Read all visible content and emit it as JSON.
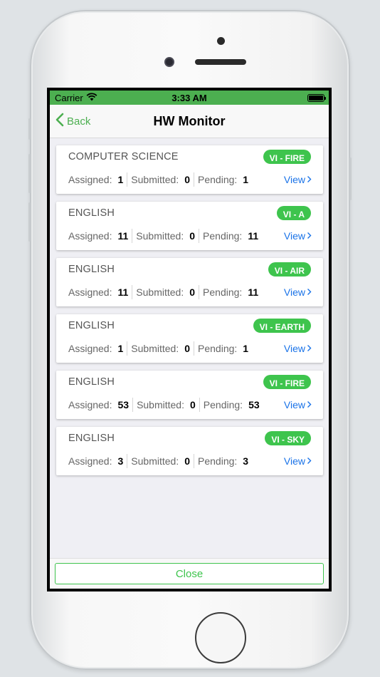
{
  "status_bar": {
    "carrier": "Carrier",
    "time": "3:33 AM",
    "battery_level": 1.0,
    "wifi_icon": "wifi-icon",
    "battery_icon": "battery-icon"
  },
  "nav": {
    "back_label": "Back",
    "title": "HW Monitor"
  },
  "labels": {
    "assigned": "Assigned:",
    "submitted": "Submitted:",
    "pending": "Pending:",
    "view": "View"
  },
  "cards": [
    {
      "subject": "COMPUTER SCIENCE",
      "section": "VI - FIRE",
      "assigned": "1",
      "submitted": "0",
      "pending": "1"
    },
    {
      "subject": "ENGLISH",
      "section": "VI - A",
      "assigned": "11",
      "submitted": "0",
      "pending": "11"
    },
    {
      "subject": "ENGLISH",
      "section": "VI - AIR",
      "assigned": "11",
      "submitted": "0",
      "pending": "11"
    },
    {
      "subject": "ENGLISH",
      "section": "VI - EARTH",
      "assigned": "1",
      "submitted": "0",
      "pending": "1"
    },
    {
      "subject": "ENGLISH",
      "section": "VI - FIRE",
      "assigned": "53",
      "submitted": "0",
      "pending": "53"
    },
    {
      "subject": "ENGLISH",
      "section": "VI - SKY",
      "assigned": "3",
      "submitted": "0",
      "pending": "3"
    }
  ],
  "footer": {
    "close_label": "Close"
  },
  "colors": {
    "accent": "#4caf50",
    "badge": "#3ec44d",
    "link": "#1a73e8"
  }
}
